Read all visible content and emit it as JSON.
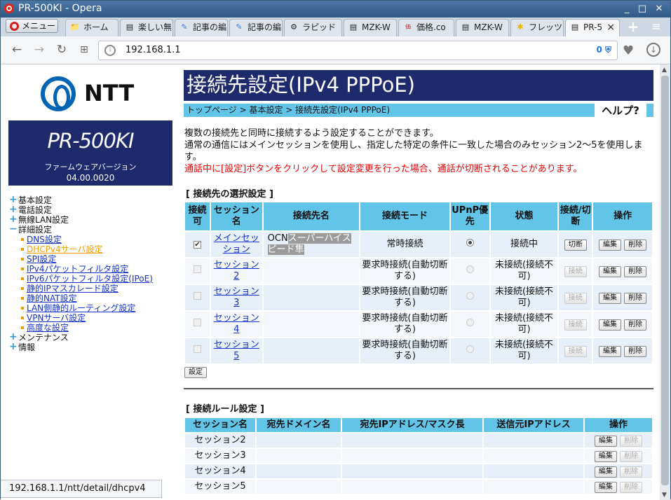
{
  "window": {
    "title": "PR-500KI - Opera"
  },
  "tabs": {
    "menu_label": "メニュー",
    "items": [
      {
        "label": "ホーム",
        "icon": "folder-icon"
      },
      {
        "label": "楽しい無",
        "icon": "page-icon"
      },
      {
        "label": "記事の編",
        "icon": "edit-icon"
      },
      {
        "label": "記事の編",
        "icon": "edit-icon"
      },
      {
        "label": "ラピッド",
        "icon": "rapid-icon"
      },
      {
        "label": "MZK-W",
        "icon": "page-icon"
      },
      {
        "label": "価格.co",
        "icon": "kakaku-icon"
      },
      {
        "label": "MZK-W",
        "icon": "page-icon"
      },
      {
        "label": "フレッツ",
        "icon": "flets-icon"
      },
      {
        "label": "PR-5",
        "icon": "page-icon"
      }
    ]
  },
  "address": {
    "url": "192.168.1.1",
    "adblock_count": "0"
  },
  "logo": {
    "text": "NTT"
  },
  "model": {
    "name": "PR-500KI",
    "fw_label": "ファームウェアバージョン",
    "version": "04.00.0020"
  },
  "nav": {
    "basic": "基本設定",
    "phone": "電話設定",
    "wlan": "無線LAN設定",
    "detail": "詳細設定",
    "sub": [
      "DNS設定",
      "DHCPv4サーバ設定",
      "SPI設定",
      "IPv4パケットフィルタ設定",
      "IPv6パケットフィルタ設定(IPoE)",
      "静的IPマスカレード設定",
      "静的NAT設定",
      "LAN側静的ルーティング設定",
      "VPNサーバ設定",
      "高度な設定"
    ],
    "maint": "メンテナンス",
    "info": "情報"
  },
  "page": {
    "title": "接続先設定(IPv4 PPPoE)",
    "breadcrumb": "トップページ > 基本設定 > 接続先設定(IPv4 PPPoE)",
    "help": "ヘルプ?",
    "desc1": "複数の接続先と同時に接続するよう設定することができます。",
    "desc2": "通常の通信にはメインセッションを使用し、指定した特定の条件に一致した場合のみセッション2〜5を使用します。",
    "warn": "通話中に[設定]ボタンをクリックして設定変更を行った場合、通話が切断されることがあります。",
    "sect1": "[ 接続先の選択設定 ]",
    "sect2": "[ 接続ルール設定 ]",
    "set_btn": "設定"
  },
  "t1": {
    "headers": {
      "enable": "接続可",
      "session": "セッション名",
      "dest": "接続先名",
      "mode": "接続モード",
      "upnp": "UPnP優先",
      "state": "状態",
      "conn": "接続/切断",
      "op": "操作"
    },
    "rows": [
      {
        "session": "メインセッション",
        "dest_a": "OCN",
        "dest_b": "スーパーハイスピード隼",
        "mode": "常時接続",
        "state": "接続中",
        "conn": "切断",
        "edit": "編集",
        "del": "削除"
      },
      {
        "session": "セッション2",
        "dest_a": "",
        "dest_b": "",
        "mode": "要求時接続(自動切断する)",
        "state": "未接続(接続不可)",
        "conn": "接続",
        "edit": "編集",
        "del": "削除"
      },
      {
        "session": "セッション3",
        "dest_a": "",
        "dest_b": "",
        "mode": "要求時接続(自動切断する)",
        "state": "未接続(接続不可)",
        "conn": "接続",
        "edit": "編集",
        "del": "削除"
      },
      {
        "session": "セッション4",
        "dest_a": "",
        "dest_b": "",
        "mode": "要求時接続(自動切断する)",
        "state": "未接続(接続不可)",
        "conn": "接続",
        "edit": "編集",
        "del": "削除"
      },
      {
        "session": "セッション5",
        "dest_a": "",
        "dest_b": "",
        "mode": "要求時接続(自動切断する)",
        "state": "未接続(接続不可)",
        "conn": "接続",
        "edit": "編集",
        "del": "削除"
      }
    ]
  },
  "t2": {
    "headers": {
      "session": "セッション名",
      "domain": "宛先ドメイン名",
      "ip": "宛先IPアドレス/マスク長",
      "src": "送信元IPアドレス",
      "op": "操作"
    },
    "rows": [
      {
        "session": "セッション2",
        "edit": "編集",
        "del": "削除"
      },
      {
        "session": "セッション3",
        "edit": "編集",
        "del": "削除"
      },
      {
        "session": "セッション4",
        "edit": "編集",
        "del": "削除"
      },
      {
        "session": "セッション5",
        "edit": "編集",
        "del": "削除"
      }
    ]
  },
  "status_url": "192.168.1.1/ntt/detail/dhcpv4"
}
